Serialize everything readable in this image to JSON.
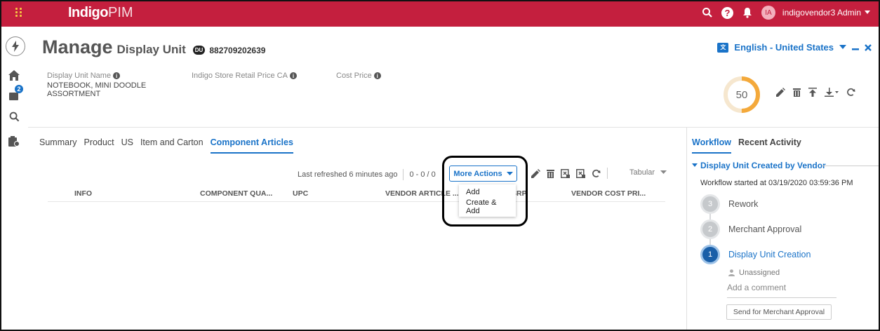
{
  "app": {
    "brand_bold": "Indigo",
    "brand_light": "PIM"
  },
  "topbar": {
    "user_name": "indigovendor3 Admin",
    "avatar_initials": "IA",
    "icons": [
      "search-icon",
      "help-icon",
      "bell-icon",
      "avatar"
    ]
  },
  "rail": {
    "notification_count": "2",
    "icons": [
      "bolt-icon",
      "home-icon",
      "tasks-icon",
      "search-icon",
      "report-icon"
    ]
  },
  "header": {
    "title_prefix": "Manage",
    "entity_type": "Display Unit",
    "entity_badge": "DU",
    "entity_id": "882709202639",
    "language": "English - United States"
  },
  "attributes": [
    {
      "label": "Display Unit Name",
      "value": "NOTEBOOK, MINI DOODLE ASSORTMENT"
    },
    {
      "label": "Indigo Store Retail Price CA",
      "value": ""
    },
    {
      "label": "Cost Price",
      "value": ""
    }
  ],
  "completeness": {
    "value": 50,
    "max": 100,
    "color": "#f4a93b"
  },
  "tabs": [
    "Summary",
    "Product",
    "US",
    "Item and Carton",
    "Component Articles"
  ],
  "active_tab": "Component Articles",
  "toolbar": {
    "last_refreshed": "Last refreshed 6 minutes ago",
    "paging": "0 - 0 / 0",
    "more_actions": "More Actions",
    "view_mode": "Tabular"
  },
  "grid": {
    "columns": [
      "INFO",
      "COMPONENT QUA...",
      "UPC",
      "VENDOR ARTICLE ...",
      "SRP",
      "VENDOR COST PRI..."
    ]
  },
  "more_actions_menu": [
    "Add",
    "Create & Add"
  ],
  "workflow": {
    "tabs": [
      "Workflow",
      "Recent Activity"
    ],
    "active_tab": "Workflow",
    "name": "Display Unit Created by Vendor",
    "started": "Workflow started at 03/19/2020 03:59:36 PM",
    "steps": [
      {
        "number": "3",
        "label": "Rework"
      },
      {
        "number": "2",
        "label": "Merchant Approval"
      },
      {
        "number": "1",
        "label": "Display Unit Creation"
      }
    ],
    "assignee": "Unassigned",
    "comment_placeholder": "Add a comment",
    "action_button": "Send for Merchant Approval"
  },
  "colors": {
    "brand": "#c41f3e",
    "accent": "#1a73c8",
    "workflow_current": "#1a5fa8"
  }
}
